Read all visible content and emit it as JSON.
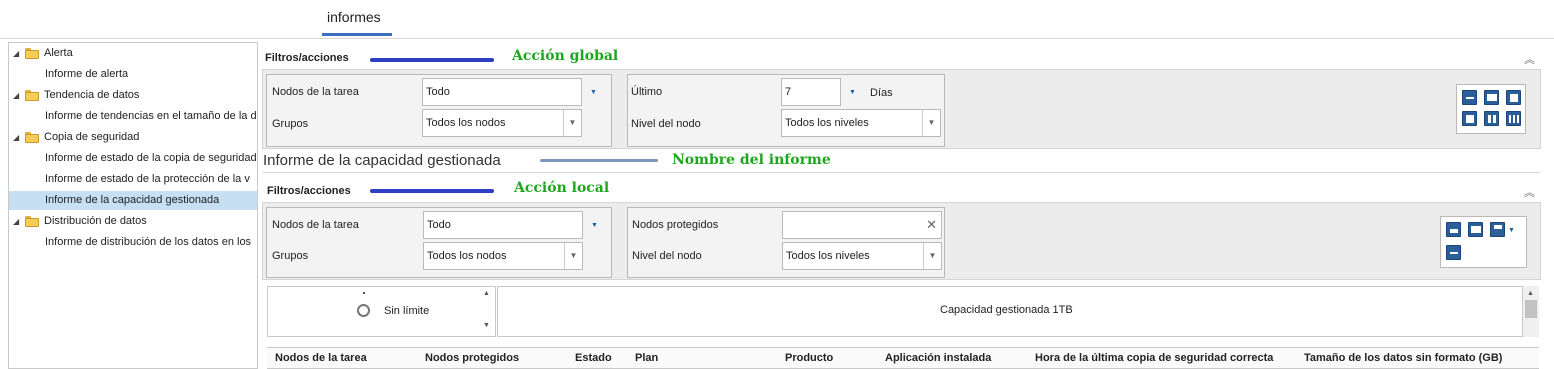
{
  "tab": {
    "title": "informes"
  },
  "tree": {
    "items": [
      {
        "label": "Alerta",
        "type": "folder"
      },
      {
        "label": "Informe de alerta",
        "type": "leaf"
      },
      {
        "label": "Tendencia de datos",
        "type": "folder"
      },
      {
        "label": "Informe de tendencias en el tamaño de la d",
        "type": "leaf"
      },
      {
        "label": "Copia de seguridad",
        "type": "folder"
      },
      {
        "label": "Informe de estado de la copia de seguridad",
        "type": "leaf"
      },
      {
        "label": "Informe de estado de la protección de la v",
        "type": "leaf"
      },
      {
        "label": "Informe de la capacidad gestionada",
        "type": "leaf",
        "selected": true
      },
      {
        "label": "Distribución de datos",
        "type": "folder"
      },
      {
        "label": "Informe de distribución de los datos en los",
        "type": "leaf"
      }
    ]
  },
  "global": {
    "section_label": "Filtros/acciones",
    "annotation": "Acción global",
    "nodos_label": "Nodos de la tarea",
    "nodos_value": "Todo",
    "grupos_label": "Grupos",
    "grupos_value": "Todos los nodos",
    "ultimo_label": "Último",
    "ultimo_value": "7",
    "dias_label": "Días",
    "nivel_label": "Nivel del nodo",
    "nivel_value": "Todos los niveles"
  },
  "report": {
    "title": "Informe de la capacidad gestionada",
    "annotation": "Nombre del informe"
  },
  "local": {
    "section_label": "Filtros/acciones",
    "annotation": "Acción local",
    "nodos_label": "Nodos de la tarea",
    "nodos_value": "Todo",
    "grupos_label": "Grupos",
    "grupos_value": "Todos los nodos",
    "protegidos_label": "Nodos protegidos",
    "protegidos_value": "",
    "nivel_label": "Nivel del nodo",
    "nivel_value": "Todos los niveles"
  },
  "chart": {
    "radio_label": "Sin límite",
    "capacity_label": "Capacidad gestionada 1TB"
  },
  "table": {
    "columns": [
      "Nodos de la tarea",
      "Nodos protegidos",
      "Estado",
      "Plan",
      "Producto",
      "Aplicación instalada",
      "Hora de la última copia de seguridad correcta",
      "Tamaño de los datos sin formato (GB)"
    ]
  },
  "colors": {
    "annotation": "#1ea71e",
    "arrow_line": "#2f3fc4",
    "selection": "#c6dff3",
    "icon": "#2a5f9a"
  }
}
